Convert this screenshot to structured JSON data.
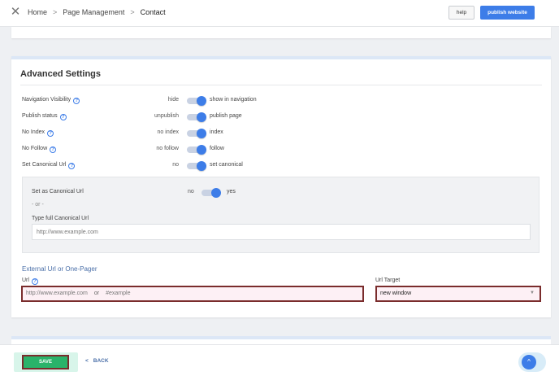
{
  "header": {
    "close_icon": "close-icon",
    "breadcrumb": [
      "Home",
      "Page Management",
      "Contact"
    ],
    "separator": ">",
    "help_label": "help",
    "publish_label": "publish website"
  },
  "advanced": {
    "title": "Advanced Settings",
    "rows": [
      {
        "label": "Navigation Visibility",
        "help": true,
        "off": "hide",
        "on": "show in navigation",
        "state": true
      },
      {
        "label": "Publish status",
        "help": true,
        "off": "unpublish",
        "on": "publish page",
        "state": true
      },
      {
        "label": "No Index",
        "help": true,
        "off": "no index",
        "on": "index",
        "state": true
      },
      {
        "label": "No Follow",
        "help": true,
        "off": "no follow",
        "on": "follow",
        "state": true
      },
      {
        "label": "Set Canonical Url",
        "help": true,
        "off": "no",
        "on": "set canonical",
        "state": true
      }
    ],
    "help_glyph": "?",
    "canonical": {
      "label": "Set as Canonical Url",
      "off": "no",
      "on": "yes",
      "or_text": "- or -",
      "type_label": "Type full Canonical Url",
      "input_placeholder": "http://www.example.com"
    },
    "external": {
      "title": "External Url or One-Pager",
      "url_label": "Url",
      "url_placeholder_a": "http://www.example.com",
      "url_or": "or",
      "url_placeholder_b": "#example",
      "target_label": "Url Target",
      "target_value": "new window"
    }
  },
  "footer": {
    "save_label": "SAVE",
    "back_label": "BACK",
    "back_glyph": "<",
    "scroll_glyph": "^"
  },
  "colors": {
    "accent": "#3d7de8",
    "save_green": "#2ab36a",
    "highlight_border": "#7a2c2c"
  }
}
